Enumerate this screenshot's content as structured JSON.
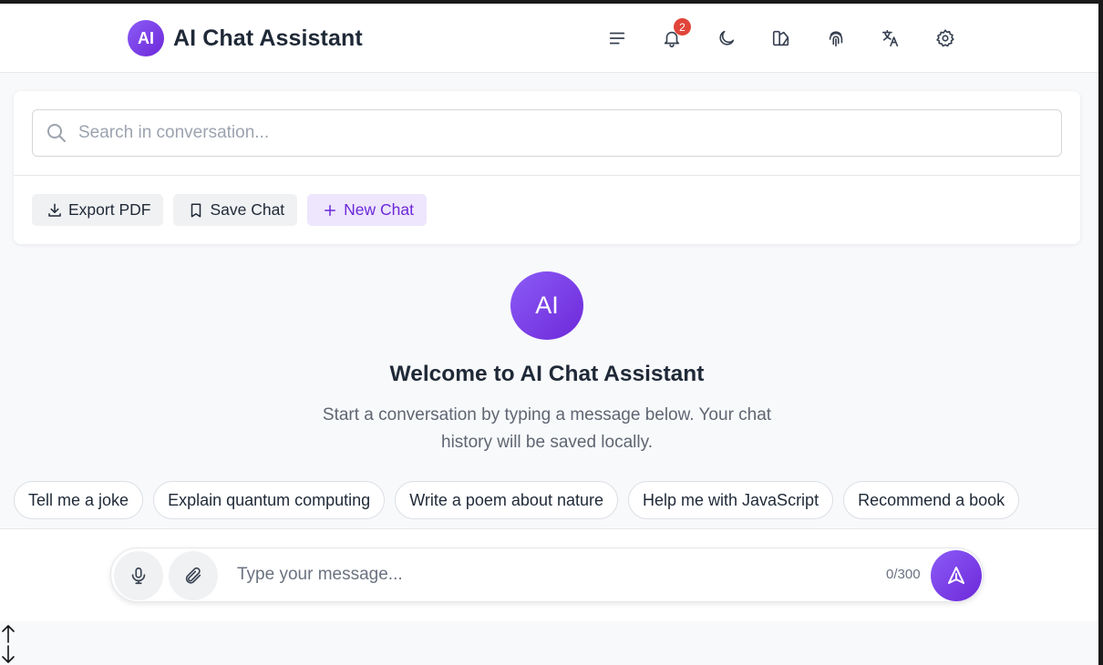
{
  "header": {
    "logo_text": "AI",
    "title": "AI Chat Assistant",
    "notification_count": "2",
    "icons": [
      "menu-icon",
      "bell-icon",
      "moon-icon",
      "palette-icon",
      "fingerprint-icon",
      "translate-icon",
      "gear-icon"
    ]
  },
  "search": {
    "placeholder": "Search in conversation..."
  },
  "actions": {
    "export_label": "Export PDF",
    "save_label": "Save Chat",
    "new_label": "New Chat"
  },
  "welcome": {
    "avatar_text": "AI",
    "title": "Welcome to AI Chat Assistant",
    "subtitle": "Start a conversation by typing a message below. Your chat history will be saved locally."
  },
  "suggestions": [
    "Tell me a joke",
    "Explain quantum computing",
    "Write a poem about nature",
    "Help me with JavaScript",
    "Recommend a book"
  ],
  "composer": {
    "placeholder": "Type your message...",
    "counter": "0/300"
  },
  "colors": {
    "accent": "#7c3aed",
    "badge": "#e0453a"
  }
}
